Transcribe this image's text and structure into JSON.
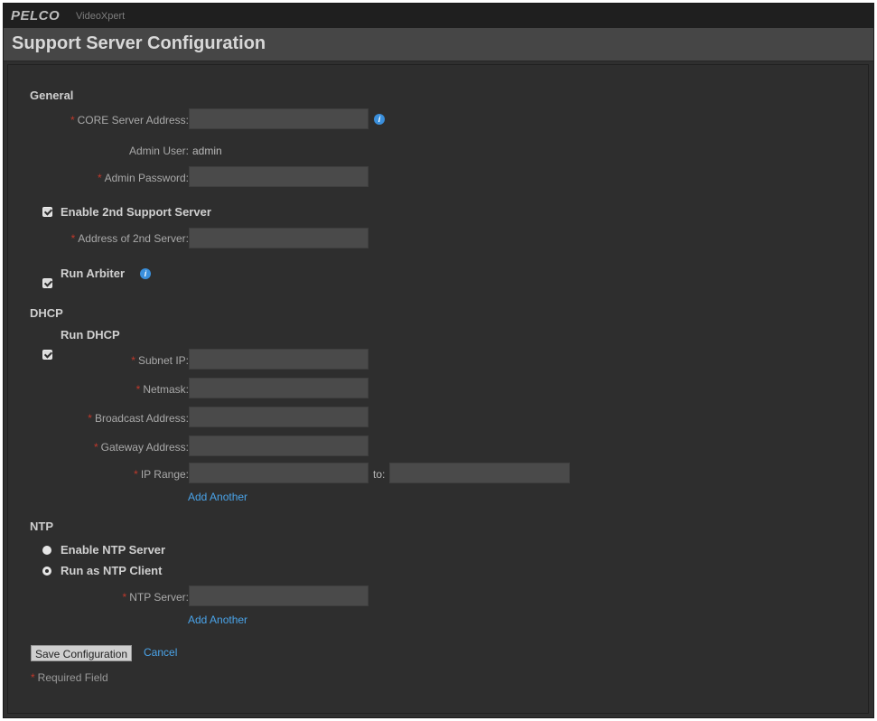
{
  "header": {
    "brand": "PELCO",
    "app_name": "VideoXpert",
    "title": "Support Server Configuration"
  },
  "general": {
    "heading": "General",
    "core_label": "CORE Server Address:",
    "admin_user_label": "Admin User:",
    "admin_user_value": "admin",
    "admin_password_label": "Admin Password:",
    "enable_2nd_label": "Enable 2nd Support Server",
    "address_2nd_label": "Address of 2nd Server:",
    "run_arbiter_label": "Run Arbiter"
  },
  "dhcp": {
    "heading": "DHCP",
    "run_dhcp_label": "Run DHCP",
    "subnet_label": "Subnet IP:",
    "netmask_label": "Netmask:",
    "broadcast_label": "Broadcast Address:",
    "gateway_label": "Gateway Address:",
    "ip_range_label": "IP Range:",
    "to_label": "to:",
    "add_another": "Add Another"
  },
  "ntp": {
    "heading": "NTP",
    "enable_server_label": "Enable NTP Server",
    "run_client_label": "Run as NTP Client",
    "server_label": "NTP Server:",
    "add_another": "Add Another"
  },
  "actions": {
    "save": "Save Configuration",
    "cancel": "Cancel"
  },
  "footer": {
    "required": "Required Field"
  },
  "required_marker": "*",
  "info_glyph": "i"
}
